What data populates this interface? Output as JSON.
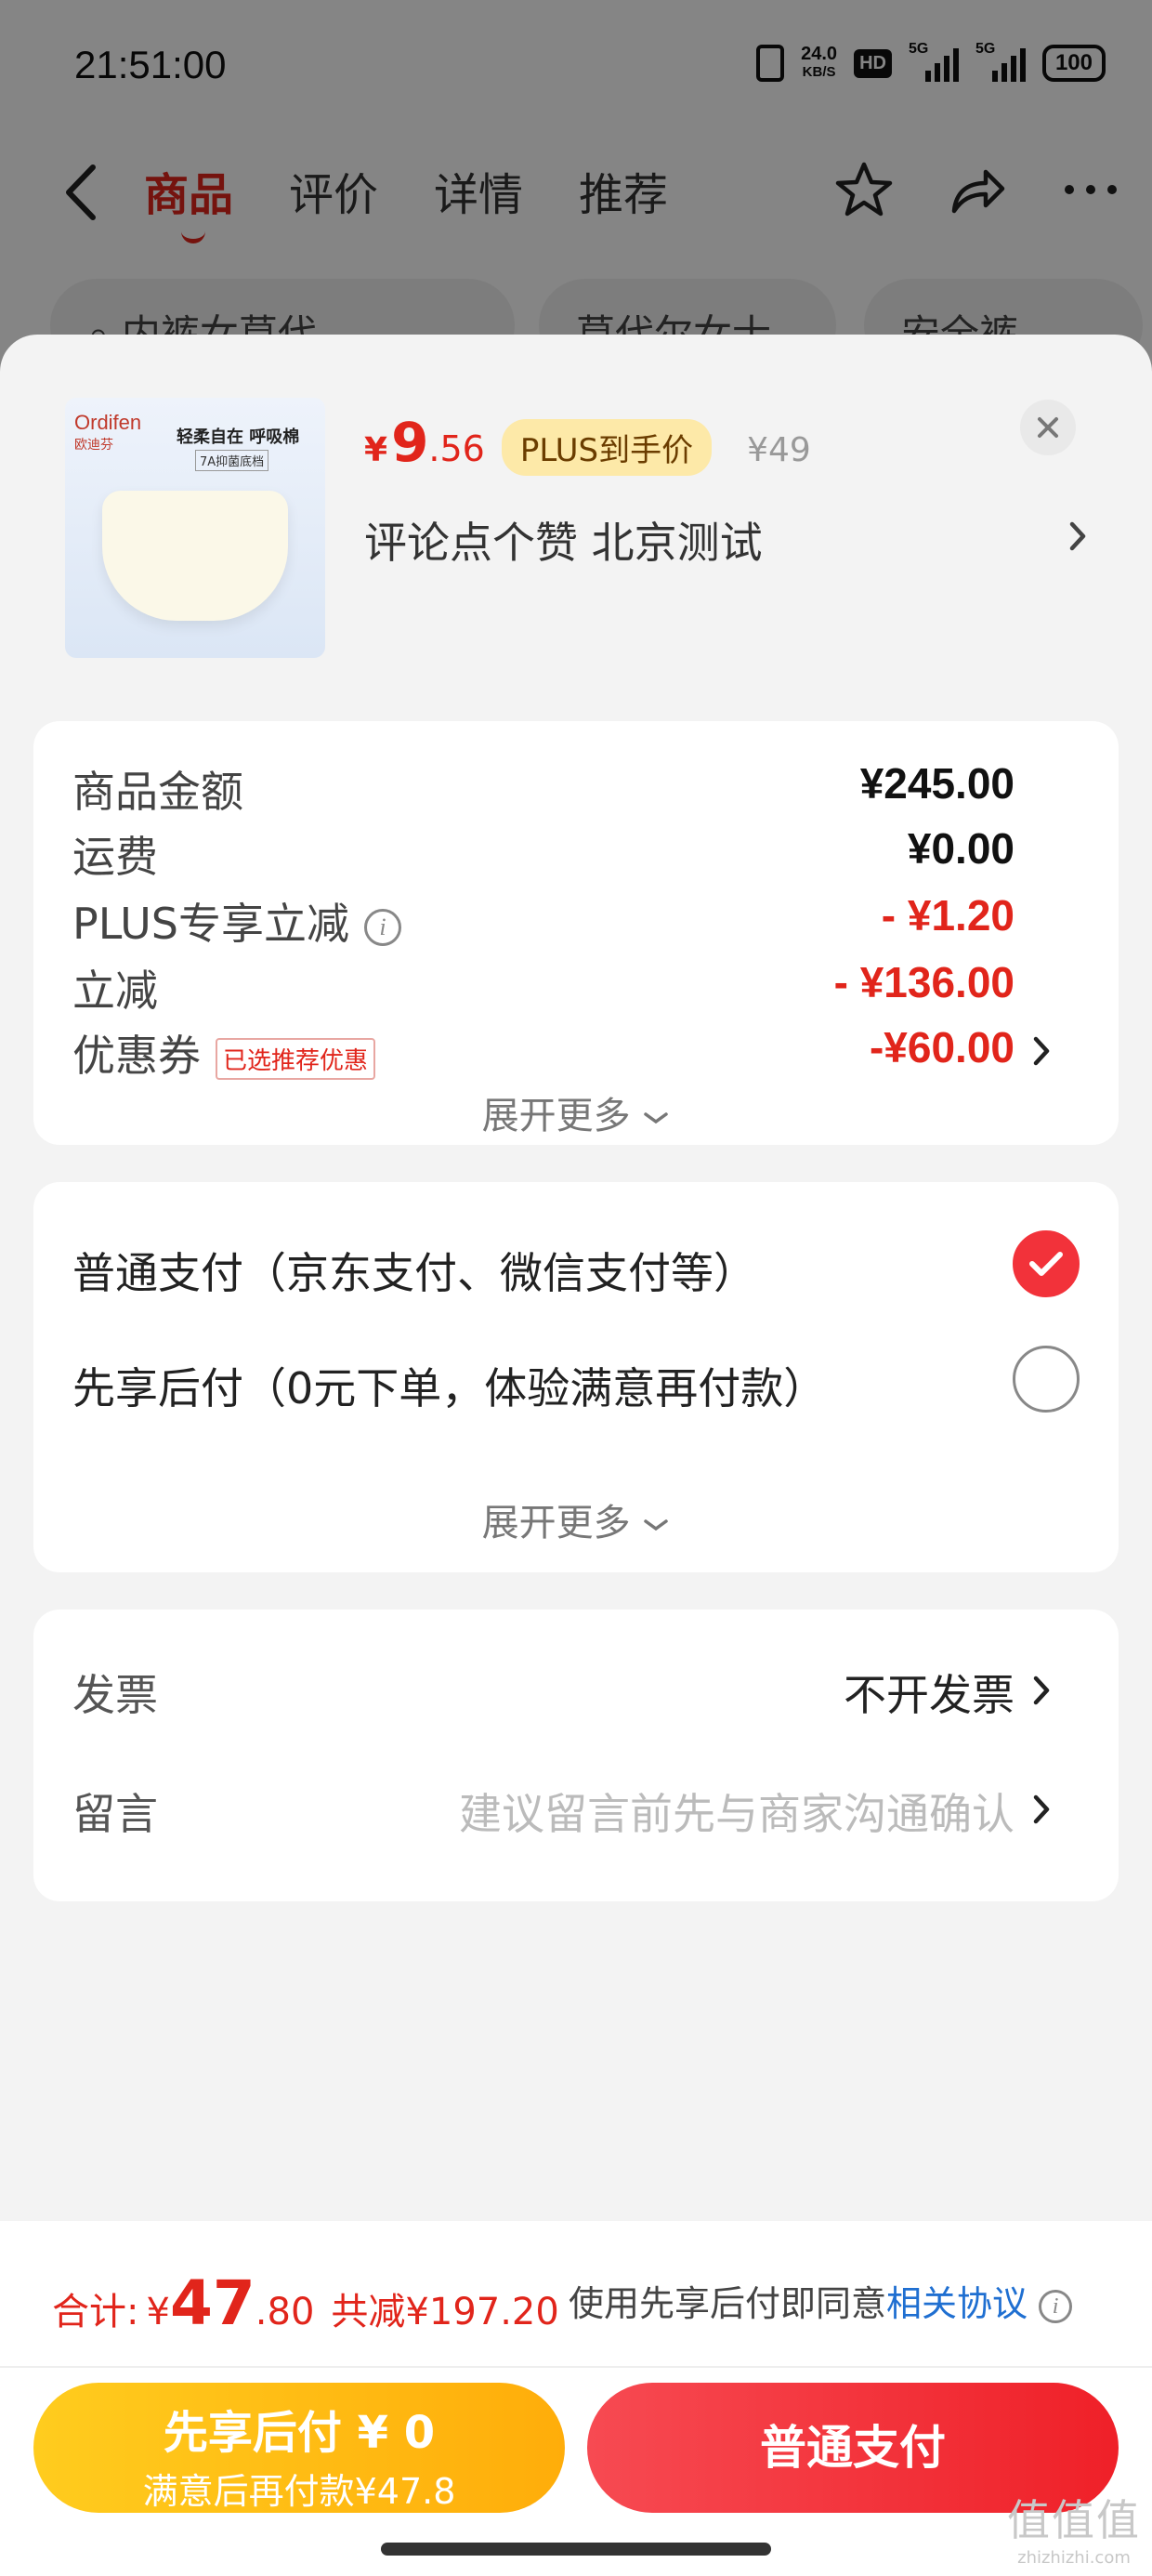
{
  "status_bar": {
    "time": "21:51:00",
    "net_speed": "24.0",
    "net_unit": "KB/S",
    "hd": "HD",
    "sig1": "5G",
    "sig2": "5G",
    "battery": "100"
  },
  "nav": {
    "tabs": [
      "商品",
      "评价",
      "详情",
      "推荐"
    ],
    "active_tab": "商品"
  },
  "background_pills": [
    "内裤女莫代",
    "莫代尔女士",
    "安全裤"
  ],
  "product": {
    "image": {
      "brand": "Ordifen",
      "brand_cn": "欧迪芬",
      "slogan": "轻柔自在 呼吸棉",
      "tag": "7A抑菌底档"
    },
    "price_symbol": "¥",
    "price_int": "9",
    "price_dec": ".56",
    "plus_badge": "PLUS到手价",
    "original_price": "¥49",
    "spec": "评论点个赞  北京测试"
  },
  "summary": {
    "rows": [
      {
        "label": "商品金额",
        "value": "¥245.00"
      },
      {
        "label": "运费",
        "value": "¥0.00"
      },
      {
        "label": "PLUS专享立减",
        "value": "- ¥1.20"
      },
      {
        "label": "立减",
        "value": "- ¥136.00"
      },
      {
        "label": "优惠券",
        "tag": "已选推荐优惠",
        "value": "-¥60.00"
      }
    ],
    "expand_label": "展开更多"
  },
  "payment": {
    "options": [
      {
        "label": "普通支付（京东支付、微信支付等）",
        "selected": true
      },
      {
        "label": "先享后付（0元下单，体验满意再付款）",
        "selected": false
      }
    ],
    "expand_label": "展开更多"
  },
  "extra": {
    "invoice_label": "发票",
    "invoice_value": "不开发票",
    "note_label": "留言",
    "note_placeholder": "建议留言前先与商家沟通确认"
  },
  "bottom": {
    "total_label": "合计:",
    "total_symbol": "¥",
    "total_int": "47",
    "total_dec": ".80",
    "saving": "共减¥197.20",
    "agree_text": "使用先享后付即同意",
    "agree_link": "相关协议",
    "btn_later_line1": "先享后付 ¥ 0",
    "btn_later_line2": "满意后再付款¥47.8",
    "btn_pay": "普通支付"
  },
  "watermark": {
    "logo": "值值值",
    "site": "zhizhizhi.com"
  },
  "colors": {
    "accent_red": "#e1251b",
    "pay_button": "#ef2028",
    "later_button": "#ffb40f",
    "link_blue": "#1f6fd1"
  }
}
